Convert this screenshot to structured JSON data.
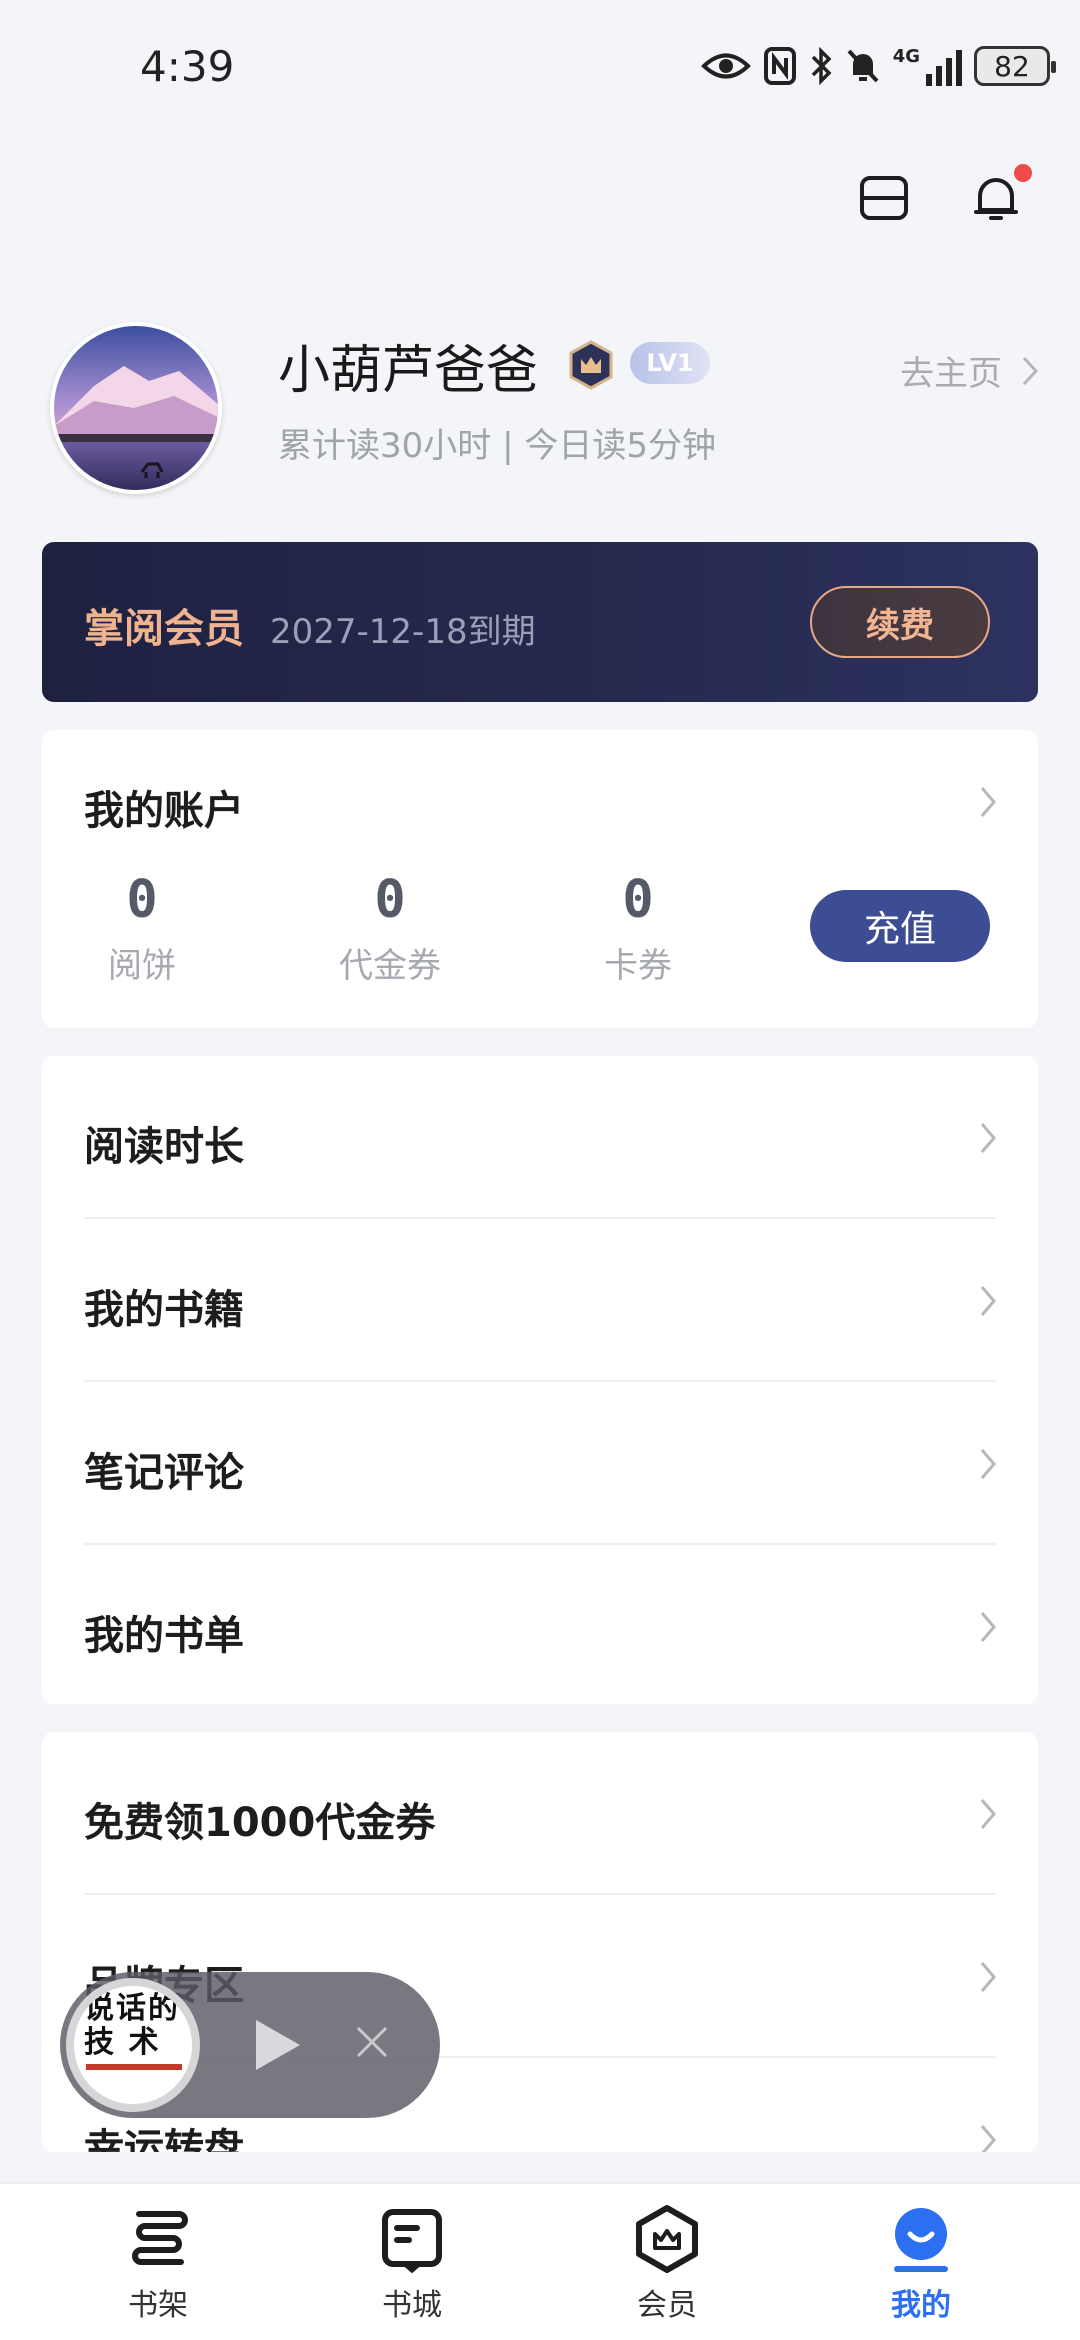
{
  "status_bar": {
    "time": "4:39",
    "network": "4G",
    "battery": "82",
    "icons": [
      "eye-icon",
      "nfc-icon",
      "bluetooth-icon",
      "mute-bell-icon",
      "signal-icon",
      "battery-icon"
    ]
  },
  "header": {
    "icons": [
      "scan-icon",
      "bell-icon"
    ],
    "notification_dot_color": "#ef4b4b"
  },
  "profile": {
    "username": "小葫芦爸爸",
    "level": "LV1",
    "reading_stats": "累计读30小时 | 今日读5分钟",
    "home_link": "去主页"
  },
  "vip": {
    "title": "掌阅会员",
    "expire": "2027-12-18到期",
    "renew_label": "续费",
    "accent_color": "#f0b38f"
  },
  "account": {
    "title": "我的账户",
    "items": [
      {
        "value": "0",
        "label": "阅饼"
      },
      {
        "value": "0",
        "label": "代金券"
      },
      {
        "value": "0",
        "label": "卡券"
      }
    ],
    "recharge_label": "充值",
    "recharge_color": "#3d4d93"
  },
  "menu_group_1": {
    "items": [
      {
        "label": "阅读时长"
      },
      {
        "label": "我的书籍"
      },
      {
        "label": "笔记评论"
      },
      {
        "label": "我的书单"
      }
    ]
  },
  "menu_group_2": {
    "items": [
      {
        "label": "免费领1000代金券"
      },
      {
        "label": "品牌专区"
      },
      {
        "label": "幸运转盘"
      }
    ]
  },
  "mini_player": {
    "cover_title": "说话的技 术"
  },
  "bottom_nav": {
    "items": [
      {
        "label": "书架",
        "icon": "bookshelf-icon"
      },
      {
        "label": "书城",
        "icon": "bookstore-icon"
      },
      {
        "label": "会员",
        "icon": "vip-icon"
      },
      {
        "label": "我的",
        "icon": "profile-icon"
      }
    ],
    "active_index": 3,
    "active_color": "#2c6ff0"
  }
}
